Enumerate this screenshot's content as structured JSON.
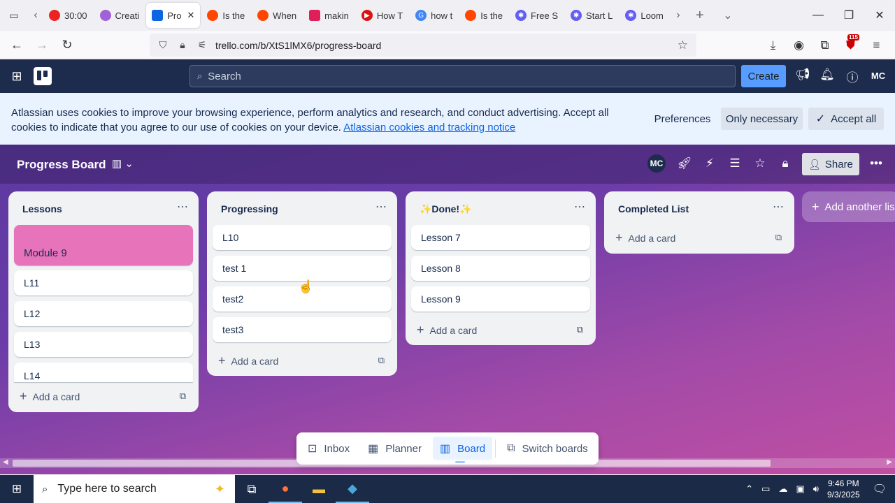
{
  "browser": {
    "tabs": [
      {
        "title": "30:00",
        "favicon_color": "#e22"
      },
      {
        "title": "Creati",
        "favicon_color": "#a260d9"
      },
      {
        "title": "Pro",
        "favicon_color": "#0c66e4",
        "active": true
      },
      {
        "title": "Is the",
        "favicon_color": "#ff4500"
      },
      {
        "title": "When",
        "favicon_color": "#ff4500"
      },
      {
        "title": "makin",
        "favicon_color": "#e01f5a"
      },
      {
        "title": "How T",
        "favicon_color": "#d11"
      },
      {
        "title": "how t",
        "favicon_color": "#4285f4"
      },
      {
        "title": "Is the",
        "favicon_color": "#ff4500"
      },
      {
        "title": "Free S",
        "favicon_color": "#625df5"
      },
      {
        "title": "Start L",
        "favicon_color": "#625df5"
      },
      {
        "title": "Loom",
        "favicon_color": "#625df5"
      }
    ],
    "url": "trello.com/b/XtS1lMX6/progress-board",
    "extension_badge": "115"
  },
  "trello": {
    "search_placeholder": "Search",
    "create_label": "Create",
    "avatar_initials": "MC"
  },
  "cookie": {
    "text": "Atlassian uses cookies to improve your browsing experience, perform analytics and research, and conduct advertising. Accept all cookies to indicate that you agree to our use of cookies on your device. ",
    "link": "Atlassian cookies and tracking notice",
    "preferences": "Preferences",
    "only_necessary": "Only necessary",
    "accept_all": "Accept all"
  },
  "board": {
    "title": "Progress Board",
    "member_initials": "MC",
    "share_label": "Share",
    "add_list_label": "Add another list",
    "lists": [
      {
        "title": "Lessons",
        "cards": [
          "Module 9",
          "L11",
          "L12",
          "L13",
          "L14"
        ],
        "add_label": "Add a card"
      },
      {
        "title": "Progressing",
        "cards": [
          "L10",
          "test 1",
          "test2",
          "test3"
        ],
        "add_label": "Add a card"
      },
      {
        "title": "✨Done!✨",
        "cards": [
          "Lesson 7",
          "Lesson 8",
          "Lesson 9"
        ],
        "add_label": "Add a card"
      },
      {
        "title": "Completed List",
        "cards": [],
        "add_label": "Add a card"
      }
    ],
    "cover_color": "#e774bb"
  },
  "bottom_nav": {
    "inbox": "Inbox",
    "planner": "Planner",
    "board": "Board",
    "switch_boards": "Switch boards"
  },
  "taskbar": {
    "search_placeholder": "Type here to search",
    "time": "9:46 PM",
    "date": "9/3/2025"
  }
}
